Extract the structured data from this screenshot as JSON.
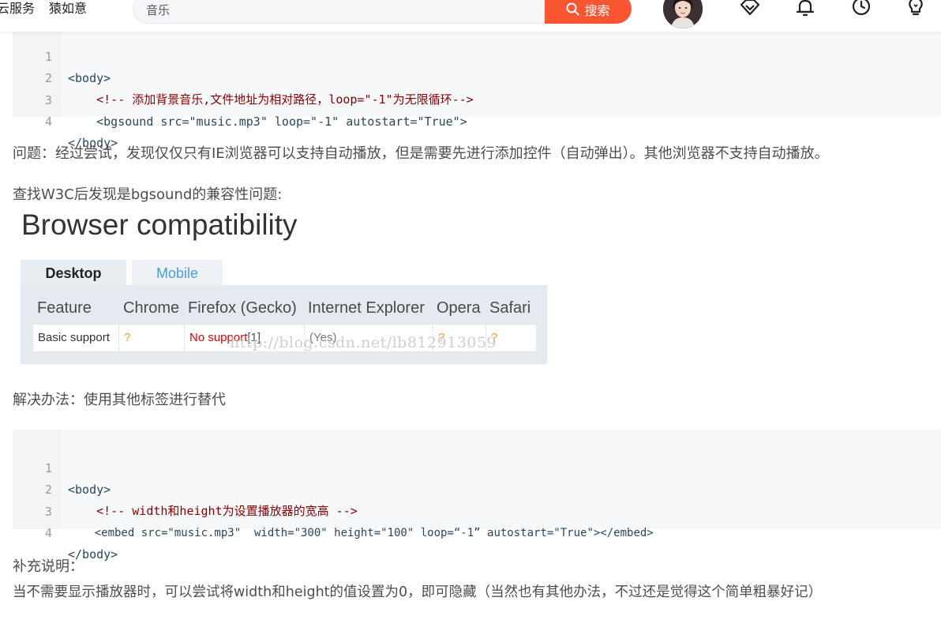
{
  "header": {
    "nav": [
      "云服务",
      "猿如意"
    ],
    "search": {
      "value": "音乐",
      "button_label": "搜索"
    },
    "icons": [
      "avatar",
      "vip-diamond-icon",
      "bell-icon",
      "history-clock-icon",
      "lightbulb-icon"
    ]
  },
  "code_block_1": {
    "line_numbers": [
      "1",
      "2",
      "3",
      "4"
    ],
    "lines": [
      "<body>",
      "    <!-- 添加背景音乐,文件地址为相对路径，loop=\"-1\"为无限循环-->",
      "    <bgsound src=\"music.mp3\" loop=\"-1\" autostart=\"True\">",
      "</body>"
    ]
  },
  "paragraphs": {
    "problem": "问题：经过尝试，发现仅仅只有IE浏览器可以支持自动播放，但是需要先进行添加控件（自动弹出）。其他浏览器不支持自动播放。",
    "w3c": "查找W3C后发现是bgsound的兼容性问题:",
    "solution": "解决办法：使用其他标签进行替代",
    "note_title": "补充说明：",
    "note_body": "当不需要显示播放器时，可以尝试将width和height的值设置为0，即可隐藏（当然也有其他办法，不过还是觉得这个简单粗暴好记）"
  },
  "compat_table": {
    "heading": "Browser compatibility",
    "tabs": [
      "Desktop",
      "Mobile"
    ],
    "columns": [
      "Feature",
      "Chrome",
      "Firefox (Gecko)",
      "Internet Explorer",
      "Opera",
      "Safari"
    ],
    "row": {
      "feature": "Basic support",
      "chrome": "?",
      "firefox": "No support",
      "firefox_note": "[1]",
      "ie": "(Yes)",
      "opera": "?",
      "safari": "?"
    },
    "watermark": "http://blog.csdn.net/lb812913059",
    "colors": {
      "no_support": "#e00000",
      "unknown": "#f0a030",
      "link_tab": "#4d9bd8"
    }
  },
  "code_block_2": {
    "line_numbers": [
      "1",
      "2",
      "3",
      "4"
    ],
    "lines": [
      "<body>",
      "    <!-- width和height为设置播放器的宽高 -->",
      "    <embed src=\"music.mp3\"  width=\"300\" height=\"100\" loop=“-1” autostart=\"True\"></embed>",
      "</body>"
    ]
  },
  "colors": {
    "accent": "#fc5531",
    "code_bg": "#f6f8fa",
    "comment": "#880000",
    "string": "#008800"
  }
}
